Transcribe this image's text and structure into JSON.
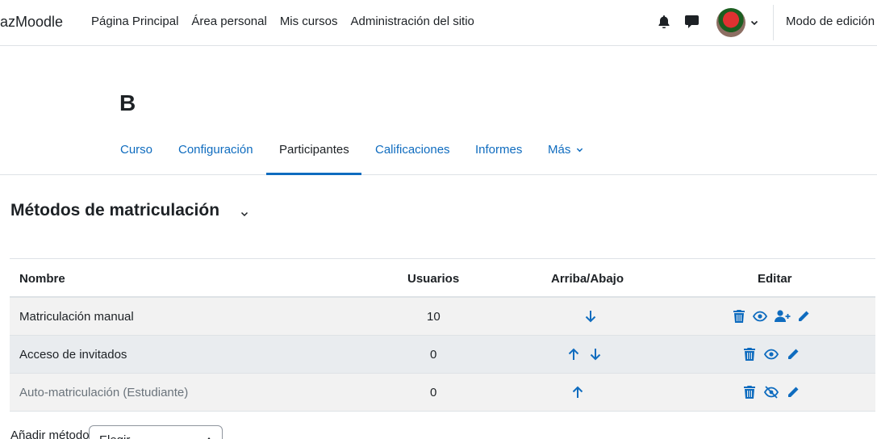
{
  "navbar": {
    "brand": "azMoodle",
    "items": [
      "Página Principal",
      "Área personal",
      "Mis cursos",
      "Administración del sitio"
    ],
    "edit_mode_label": "Modo de edición",
    "notification_icon": "bell-icon",
    "messages_icon": "chat-icon"
  },
  "course": {
    "title": "B"
  },
  "secondary_nav": {
    "tabs": [
      "Curso",
      "Configuración",
      "Participantes",
      "Calificaciones",
      "Informes",
      "Más"
    ],
    "active_tab": "Participantes"
  },
  "page": {
    "heading": "Métodos de matriculación"
  },
  "table": {
    "headers": {
      "name": "Nombre",
      "users": "Usuarios",
      "updown": "Arriba/Abajo",
      "edit": "Editar"
    },
    "rows": [
      {
        "name": "Matriculación manual",
        "users": "10",
        "move": [
          "arrow-down-icon"
        ],
        "actions": [
          "trash-icon",
          "eye-icon",
          "enrol-users-icon",
          "pencil-icon"
        ],
        "enabled": true
      },
      {
        "name": "Acceso de invitados",
        "users": "0",
        "move": [
          "arrow-up-icon",
          "arrow-down-icon"
        ],
        "actions": [
          "trash-icon",
          "eye-icon",
          "pencil-icon"
        ],
        "enabled": true
      },
      {
        "name": "Auto-matriculación (Estudiante)",
        "users": "0",
        "move": [
          "arrow-up-icon"
        ],
        "actions": [
          "trash-icon",
          "eye-slash-icon",
          "pencil-icon"
        ],
        "enabled": false
      }
    ]
  },
  "add_method": {
    "label": "Añadir método",
    "select_value": "Elegir..."
  },
  "colors": {
    "link": "#0f6cbf",
    "text": "#1d2125",
    "dimmed": "#6a737b",
    "row_odd": "#f2f2f2",
    "row_even": "#e9ecef"
  }
}
